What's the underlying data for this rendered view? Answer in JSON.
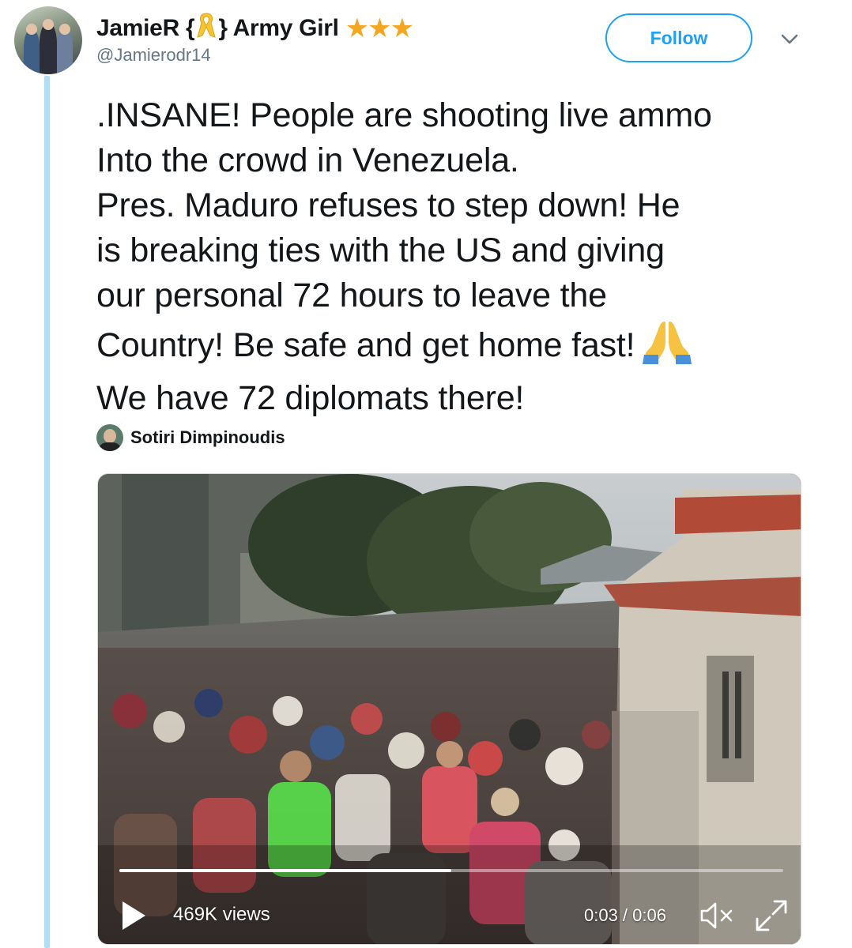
{
  "tweet": {
    "author": {
      "display_name": "JamieR {",
      "display_name_close": "} Army Girl",
      "name_emoji": "yellow-ribbon",
      "stars": "★★★",
      "stars_color": "#f5a623",
      "handle": "@Jamierodr14"
    },
    "follow_label": "Follow",
    "accent_color": "#1da1f2",
    "text_lines": [
      ".INSANE! People are shooting live ammo",
      "Into the crowd in Venezuela.",
      "Pres. Maduro refuses to step down! He",
      "is breaking ties with the US and giving",
      "our personal 72 hours to leave the",
      "Country! Be safe and get home fast!",
      "We have 72 diplomats there!"
    ],
    "text_emoji": "folded-hands",
    "attribution": {
      "name": "Sotiri Dimpinoudis"
    },
    "video": {
      "views": "469K views",
      "time": "0:03 / 0:06",
      "progress_fraction": 0.5
    }
  }
}
